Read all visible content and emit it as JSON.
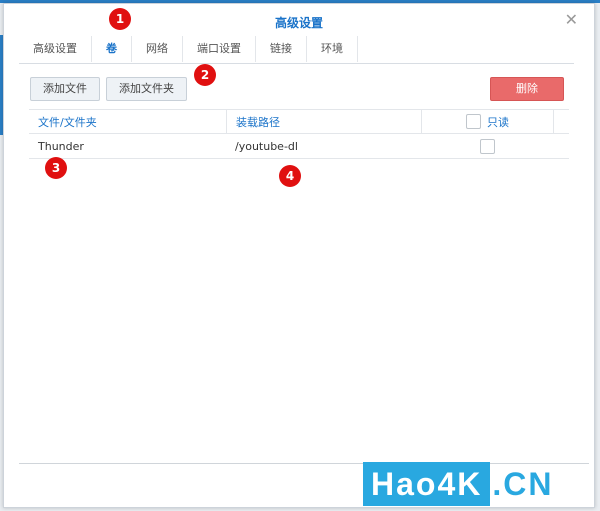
{
  "dialog": {
    "title": "高级设置"
  },
  "tabs": [
    "高级设置",
    "卷",
    "网络",
    "端口设置",
    "链接",
    "环境"
  ],
  "active_tab": "卷",
  "toolbar": {
    "add_file": "添加文件",
    "add_folder": "添加文件夹",
    "delete": "删除"
  },
  "table": {
    "headers": [
      "文件/文件夹",
      "装载路径",
      "只读"
    ],
    "rows": [
      {
        "file": "Thunder",
        "mount_path": "/youtube-dl",
        "readonly": false
      }
    ]
  },
  "markers": [
    "1",
    "2",
    "3",
    "4"
  ],
  "watermark": {
    "main": "Hao4K",
    "suffix": ".CN"
  }
}
